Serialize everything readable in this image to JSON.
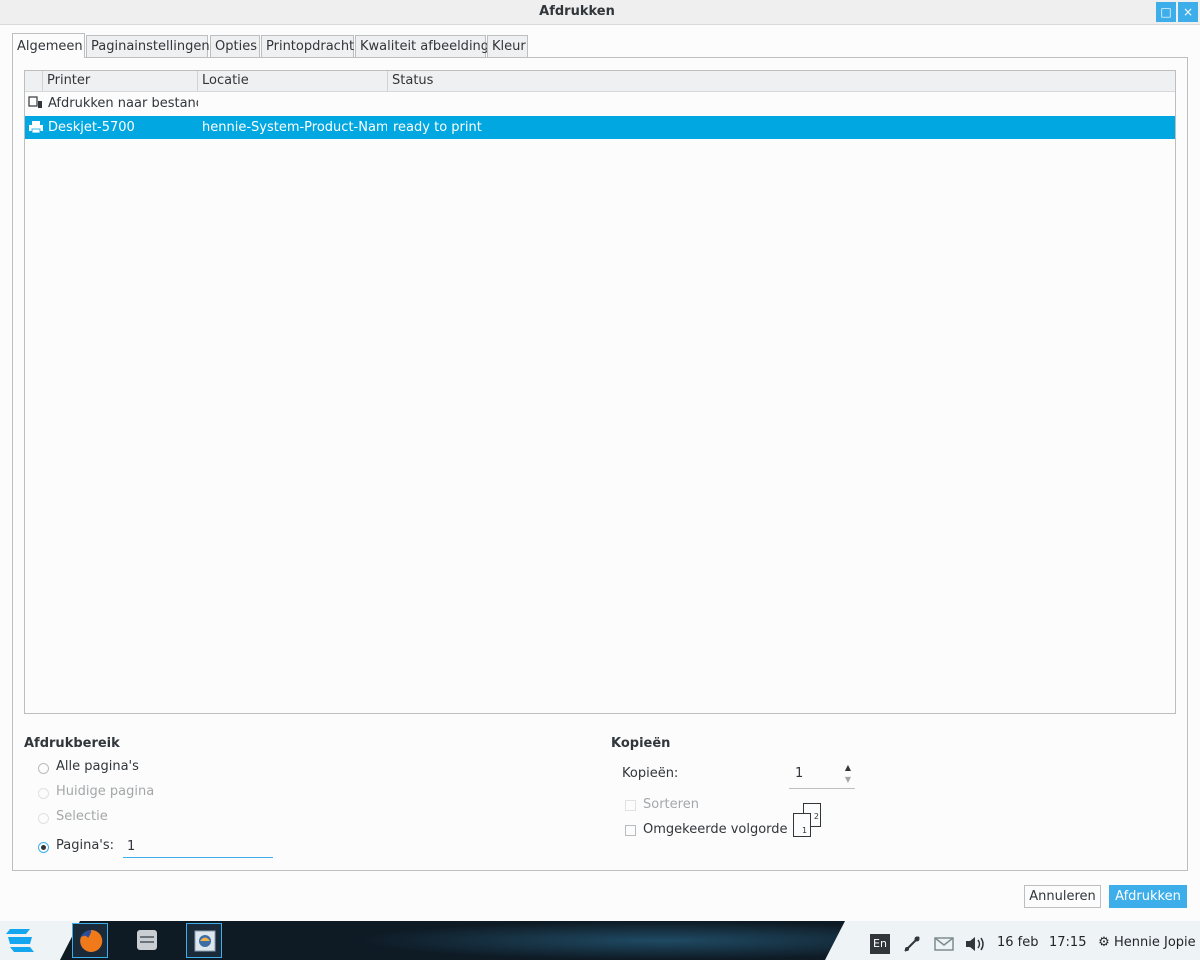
{
  "window": {
    "title": "Afdrukken",
    "maximize_glyph": "□",
    "close_glyph": "×"
  },
  "tabs": [
    {
      "label": "Algemeen",
      "active": true
    },
    {
      "label": "Paginainstellingen",
      "active": false
    },
    {
      "label": "Opties",
      "active": false
    },
    {
      "label": "Printopdracht",
      "active": false
    },
    {
      "label": "Kwaliteit afbeelding",
      "active": false
    },
    {
      "label": "Kleur",
      "active": false
    }
  ],
  "printer_list": {
    "columns": [
      "Printer",
      "Locatie",
      "Status"
    ],
    "rows": [
      {
        "icon": "file-printer-icon",
        "name": "Afdrukken naar bestand",
        "location": "",
        "status": "",
        "selected": false
      },
      {
        "icon": "printer-icon",
        "name": "Deskjet-5700",
        "location": "hennie-System-Product-Name",
        "status": "ready to print",
        "selected": true
      }
    ]
  },
  "print_range": {
    "title": "Afdrukbereik",
    "options": [
      {
        "label": "Alle pagina's",
        "checked": false,
        "enabled": true
      },
      {
        "label": "Huidige pagina",
        "checked": false,
        "enabled": false
      },
      {
        "label": "Selectie",
        "checked": false,
        "enabled": false
      },
      {
        "label": "Pagina's:",
        "checked": true,
        "enabled": true
      }
    ],
    "pages_value": "1"
  },
  "copies": {
    "title": "Kopieën",
    "label": "Kopieën:",
    "value": "1",
    "collate_label": "Sorteren",
    "reverse_label": "Omgekeerde volgorde",
    "page_icon_labels": [
      "1",
      "2"
    ]
  },
  "buttons": {
    "cancel": "Annuleren",
    "print": "Afdrukken"
  },
  "taskbar": {
    "apps": [
      "firefox-icon",
      "file-manager-icon",
      "thunderbird-icon"
    ],
    "lang": "En",
    "date": "16 feb",
    "time": "17:15",
    "user": "Hennie Jopie",
    "accent": "#3daee9",
    "selection": "#00a7e1"
  }
}
